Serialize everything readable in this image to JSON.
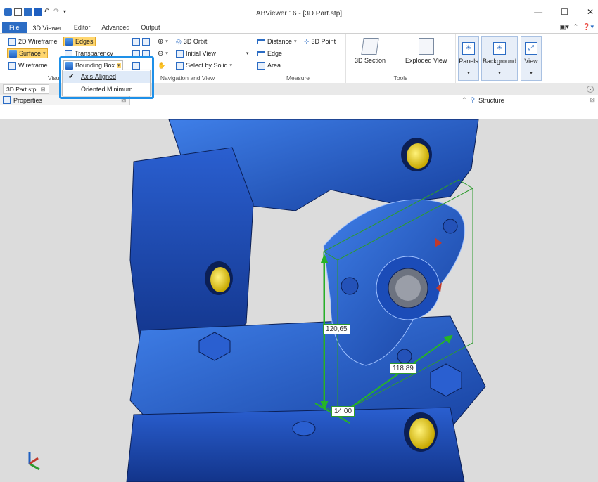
{
  "window": {
    "title": "ABViewer 16 - [3D Part.stp]",
    "minimize": "—",
    "maximize": "☐",
    "close": "✕"
  },
  "tabs": [
    "File",
    "3D Viewer",
    "Editor",
    "Advanced",
    "Output"
  ],
  "ribbon": {
    "visual_styles": {
      "wireframe2d": "2D Wireframe",
      "surface": "Surface",
      "wireframe": "Wireframe",
      "label": "Visu"
    },
    "display": {
      "edges": "Edges",
      "transparency": "Transparency",
      "bounding_box": "Bounding Box"
    },
    "navigation": {
      "orbit": "3D Orbit",
      "initial_view": "Initial View",
      "select_by_solid": "Select by Solid",
      "label": "Navigation and View"
    },
    "measure": {
      "distance": "Distance",
      "point": "3D Point",
      "edge": "Edge",
      "area": "Area",
      "label": "Measure"
    },
    "tools": {
      "section": "3D Section",
      "exploded": "Exploded View",
      "label": "Tools"
    },
    "panels": {
      "panels": "Panels",
      "background": "Background",
      "view": "View"
    }
  },
  "dropdown": {
    "items": [
      {
        "label": "Axis-Aligned",
        "checked": true
      },
      {
        "label": "Oriented Minimum",
        "checked": false
      }
    ]
  },
  "document_tab": "3D Part.stp",
  "panels": {
    "properties": "Properties",
    "structure": "Structure"
  },
  "dimensions": {
    "height": "120,65",
    "width": "118,89",
    "depth": "14,00"
  },
  "colors": {
    "accent": "#2b6cc4",
    "highlight": "#ffd66e",
    "focus": "#1e90e8",
    "model": "#1f55c8",
    "bbox": "#2e9b2e"
  }
}
